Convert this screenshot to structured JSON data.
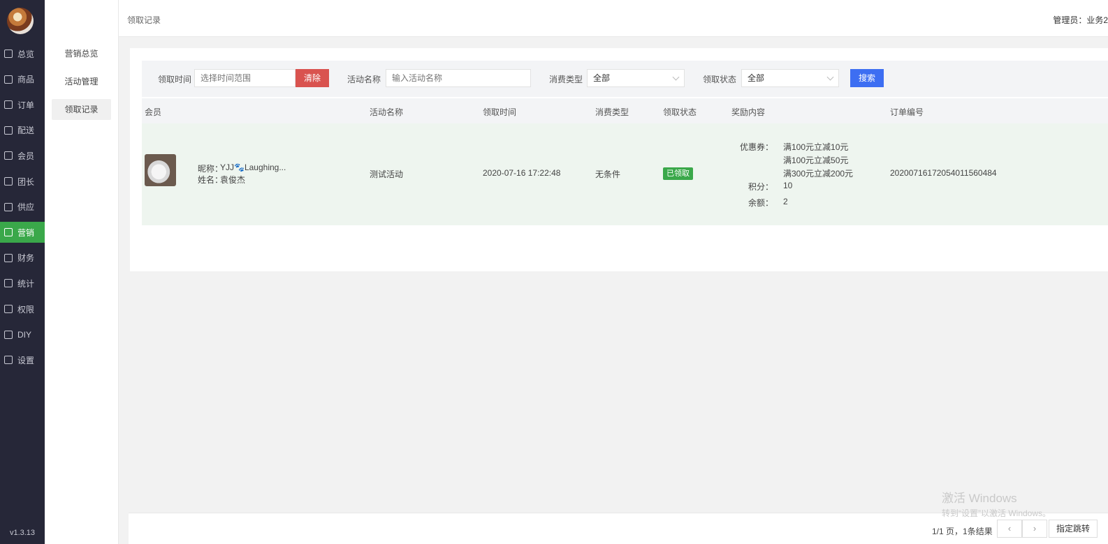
{
  "nav": {
    "items": [
      {
        "label": "总览",
        "icon": "home-icon"
      },
      {
        "label": "商品",
        "icon": "goods-icon"
      },
      {
        "label": "订单",
        "icon": "order-icon"
      },
      {
        "label": "配送",
        "icon": "delivery-icon"
      },
      {
        "label": "会员",
        "icon": "member-icon"
      },
      {
        "label": "团长",
        "icon": "leader-icon"
      },
      {
        "label": "供应",
        "icon": "supply-icon"
      },
      {
        "label": "营销",
        "icon": "gift-icon"
      },
      {
        "label": "财务",
        "icon": "finance-icon"
      },
      {
        "label": "统计",
        "icon": "pie-icon"
      },
      {
        "label": "权限",
        "icon": "shield-icon"
      },
      {
        "label": "DIY",
        "icon": "layout-icon"
      },
      {
        "label": "设置",
        "icon": "gear-icon"
      }
    ],
    "active_index": 7,
    "version": "v1.3.13"
  },
  "submenu": {
    "items": [
      "营销总览",
      "活动管理",
      "领取记录"
    ],
    "active_index": 2
  },
  "header": {
    "breadcrumb": "领取记录",
    "admin": "管理员：业务2"
  },
  "filter": {
    "time_label": "领取时间",
    "time_placeholder": "选择时间范围",
    "clear_label": "清除",
    "activity_label": "活动名称",
    "activity_placeholder": "输入活动名称",
    "consume_label": "消费类型",
    "consume_value": "全部",
    "status_label": "领取状态",
    "status_value": "全部",
    "search_label": "搜索"
  },
  "table": {
    "columns": [
      "会员",
      "活动名称",
      "领取时间",
      "消费类型",
      "领取状态",
      "奖励内容",
      "订单编号"
    ],
    "rows": [
      {
        "nickname_label": "昵称：",
        "nickname": "YJJ🐾Laughing...",
        "name_label": "姓名：",
        "name": "袁俊杰",
        "activity": "测试活动",
        "time": "2020-07-16 17:22:48",
        "consume_type": "无条件",
        "status": "已领取",
        "coupon_label": "优惠券：",
        "coupons": [
          "满100元立减10元",
          "满100元立减50元",
          "满300元立减200元"
        ],
        "points_label": "积分：",
        "points": "10",
        "balance_label": "余额：",
        "balance": "2",
        "order_no": "20200716172054011560484"
      }
    ]
  },
  "pager": {
    "info": "1/1 页，1条结果",
    "prev": "‹",
    "next": "›",
    "jump_label": "指定跳转"
  },
  "watermark": {
    "line1": "激活 Windows",
    "line2": "转到“设置”以激活 Windows。"
  },
  "colors": {
    "nav_bg": "#262738",
    "accent_green": "#3aa84a",
    "clear_red": "#d9534f",
    "search_blue": "#3d6ef2"
  }
}
